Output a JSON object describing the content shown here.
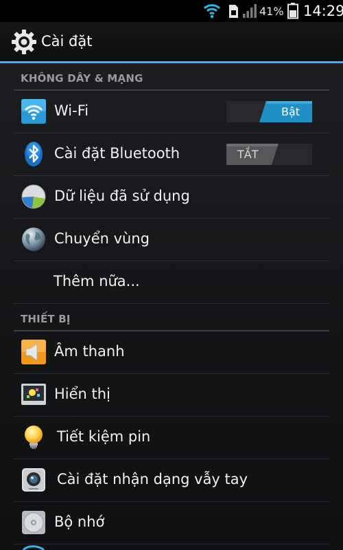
{
  "status_bar": {
    "battery_percent": "41%",
    "time": "14:29",
    "icons": [
      "wifi-signal-icon",
      "sim-card-icon",
      "cell-signal-icon",
      "battery-icon"
    ]
  },
  "action_bar": {
    "title": "Cài đặt",
    "icon": "gear-icon"
  },
  "sections": {
    "wireless": {
      "header": "KHÔNG DÂY & MẠNG",
      "items": {
        "wifi": {
          "label": "Wi-Fi",
          "icon": "wifi-icon",
          "toggle": "Bật",
          "state": "on"
        },
        "bluetooth": {
          "label": "Cài đặt Bluetooth",
          "icon": "bluetooth-icon",
          "toggle": "TẮT",
          "state": "off"
        },
        "data_usage": {
          "label": "Dữ liệu đã sử dụng",
          "icon": "data-usage-icon"
        },
        "roaming": {
          "label": "Chuyển vùng",
          "icon": "globe-icon"
        },
        "more": {
          "label": "Thêm nữa..."
        }
      }
    },
    "device": {
      "header": "THIẾT BỊ",
      "items": {
        "sound": {
          "label": "Âm thanh",
          "icon": "speaker-icon"
        },
        "display": {
          "label": "Hiển thị",
          "icon": "display-icon"
        },
        "power_saving": {
          "label": "Tiết kiệm pin",
          "icon": "light-bulb-icon"
        },
        "gesture": {
          "label": "Cài đặt nhận dạng vẫy tay",
          "icon": "camera-icon"
        },
        "storage": {
          "label": "Bộ nhớ",
          "icon": "storage-disc-icon"
        }
      }
    }
  },
  "colors": {
    "accent": "#33b5e5",
    "toggle_on": "#1f8fc4",
    "toggle_off": "#555759"
  }
}
